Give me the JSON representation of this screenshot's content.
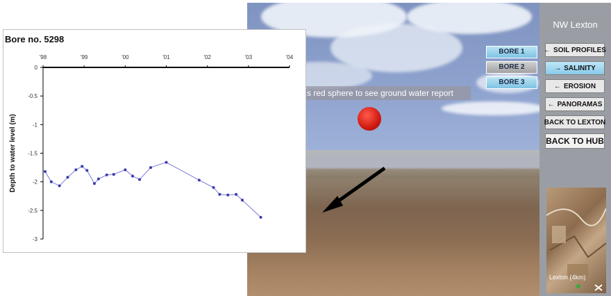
{
  "scene": {
    "hint_text": "s red sphere to see ground water report",
    "colors": {
      "sky": "#8fa3cf",
      "ground": "#8a6c52",
      "sphere": "#d01a10"
    }
  },
  "bores": [
    {
      "label": "BORE 1",
      "style": "blue"
    },
    {
      "label": "BORE 2",
      "style": "grey"
    },
    {
      "label": "BORE 3",
      "style": "blue"
    }
  ],
  "panel": {
    "title": "NW Lexton",
    "buttons": [
      {
        "label": "SOIL PROFILES",
        "arrow": "←",
        "active": false
      },
      {
        "label": "SALINITY",
        "arrow": "→",
        "active": true
      },
      {
        "label": "EROSION",
        "arrow": "←",
        "active": false
      },
      {
        "label": "PANORAMAS",
        "arrow": "←",
        "active": false
      },
      {
        "label": "BACK TO LEXTON",
        "arrow": "",
        "active": false
      },
      {
        "label": "BACK TO HUB",
        "arrow": "",
        "active": false,
        "big": true
      }
    ],
    "map_label": "Lexton (4km)"
  },
  "chart": {
    "title": "Bore no. 5298",
    "chart_data": {
      "type": "line",
      "title": "Bore no. 5298",
      "ylabel": "Depth to water level (m)",
      "xlabel": "",
      "x_ticks": [
        "'98",
        "'99",
        "'00",
        "'01",
        "'02",
        "'03",
        "'04"
      ],
      "y_ticks": [
        "0",
        "-0.5",
        "-1",
        "-1.5",
        "-2",
        "-2.5",
        "-3"
      ],
      "xlim": [
        1998,
        2004
      ],
      "ylim": [
        -3,
        0
      ],
      "grid": false,
      "series": [
        {
          "x": [
            1998.05,
            1998.2,
            1998.4,
            1998.6,
            1998.8,
            1998.95,
            1999.07,
            1999.25,
            1999.35,
            1999.55,
            1999.72,
            2000.0,
            2000.18,
            2000.35,
            2000.62,
            2001.0,
            2001.8,
            2002.15,
            2002.3,
            2002.5,
            2002.7,
            2002.85,
            2003.3
          ],
          "y": [
            -1.82,
            -2.0,
            -2.07,
            -1.92,
            -1.79,
            -1.73,
            -1.8,
            -2.03,
            -1.95,
            -1.88,
            -1.87,
            -1.79,
            -1.9,
            -1.96,
            -1.75,
            -1.66,
            -1.97,
            -2.1,
            -2.22,
            -2.23,
            -2.22,
            -2.32,
            -2.62
          ]
        }
      ]
    }
  }
}
